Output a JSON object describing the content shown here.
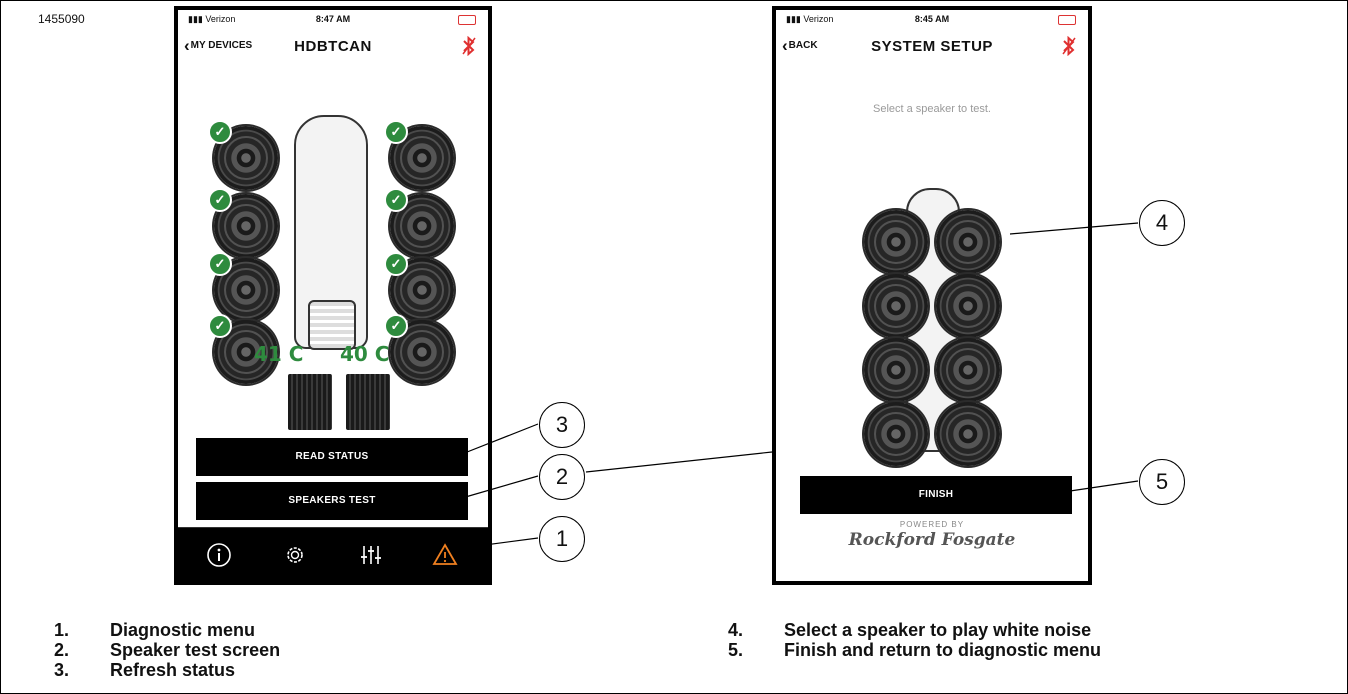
{
  "figure_id": "1455090",
  "phone_left": {
    "carrier": "Verizon",
    "time": "8:47 AM",
    "back_label": "MY DEVICES",
    "title": "HDBTCAN",
    "temps": [
      "41 C",
      "40 C"
    ],
    "read_status_label": "READ STATUS",
    "speakers_test_label": "SPEAKERS TEST",
    "tabs": [
      "info-icon",
      "gear-icon",
      "equalizer-icon",
      "warning-icon"
    ]
  },
  "phone_right": {
    "carrier": "Verizon",
    "time": "8:45 AM",
    "back_label": "BACK",
    "title": "SYSTEM SETUP",
    "subtitle": "Select a speaker to test.",
    "finish_label": "FINISH",
    "powered_by": "POWERED BY",
    "brand": "Rockford Fosgate"
  },
  "callouts": [
    "1",
    "2",
    "3",
    "4",
    "5"
  ],
  "legend_left": [
    {
      "num": "1.",
      "text": "Diagnostic menu"
    },
    {
      "num": "2.",
      "text": "Speaker test screen"
    },
    {
      "num": "3.",
      "text": "Refresh status"
    }
  ],
  "legend_right": [
    {
      "num": "4.",
      "text": "Select a speaker to play white noise"
    },
    {
      "num": "5.",
      "text": "Finish and return to diagnostic menu"
    }
  ],
  "colors": {
    "check": "#2e8b3e",
    "bluetooth": "#e03030",
    "warning": "#f08020",
    "temp": "#2e8b3e"
  }
}
